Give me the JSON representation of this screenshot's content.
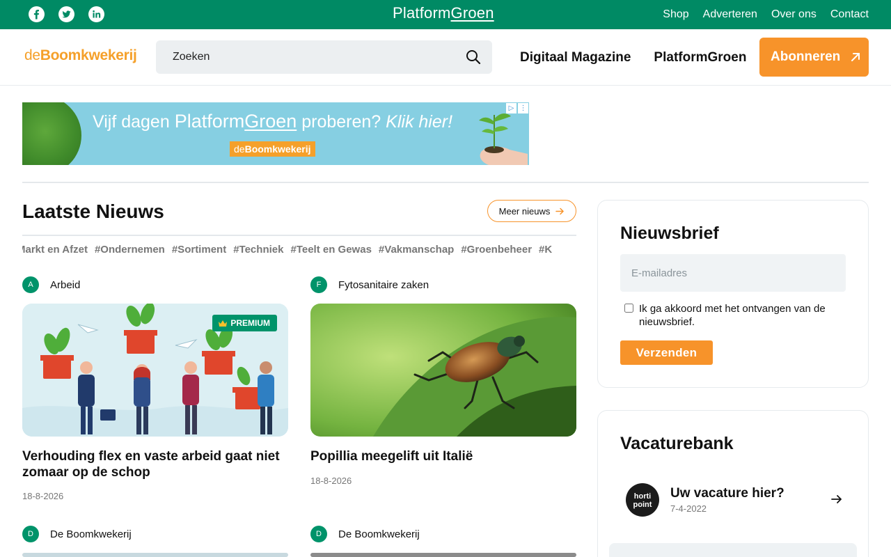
{
  "topbar": {
    "social": [
      "facebook-icon",
      "twitter-icon",
      "linkedin-icon"
    ],
    "brand_left": "Platform",
    "brand_right": "Groen",
    "nav": [
      "Shop",
      "Adverteren",
      "Over ons",
      "Contact"
    ]
  },
  "header": {
    "logo_prefix": "de",
    "logo_main": "Boomkwekerij",
    "search_placeholder": "Zoeken",
    "nav": [
      "Digitaal Magazine",
      "PlatformGroen"
    ],
    "subscribe_label": "Abonneren"
  },
  "banner": {
    "text_before": "Vijf dagen ",
    "brand_left": "Platform",
    "brand_right": "Groen",
    "text_after": " proberen? ",
    "cta": "Klik hier!",
    "chip_prefix": "de",
    "chip_main": "Boomkwekerij"
  },
  "news": {
    "title": "Laatste Nieuws",
    "more_label": "Meer nieuws",
    "tags": [
      "Markt en Afzet",
      "#Ondernemen",
      "#Sortiment",
      "#Techniek",
      "#Teelt en Gewas",
      "#Vakmanschap",
      "#Groenbeheer",
      "#K"
    ],
    "articles": [
      {
        "initial": "A",
        "category": "Arbeid",
        "badge": "PREMIUM",
        "headline": "Verhouding flex en vaste arbeid gaat niet zomaar op de schop",
        "date": "18-8-2026"
      },
      {
        "initial": "F",
        "category": "Fytosanitaire zaken",
        "headline": "Popillia meegelift uit Italië",
        "date": "18-8-2026"
      },
      {
        "initial": "D",
        "category": "De Boomkwekerij"
      },
      {
        "initial": "D",
        "category": "De Boomkwekerij"
      }
    ]
  },
  "newsletter": {
    "title": "Nieuwsbrief",
    "email_placeholder": "E-mailadres",
    "agree_label": "Ik ga akkoord met het ontvangen van de nieuwsbrief.",
    "send_label": "Verzenden"
  },
  "vacatures": {
    "title": "Vacaturebank",
    "item": {
      "logo_line1": "horti",
      "logo_line2": "point",
      "title": "Uw vacature hier?",
      "date": "7-4-2022"
    }
  },
  "colors": {
    "green": "#008a64",
    "orange": "#f7932a",
    "banner_blue": "#86cfe2"
  }
}
